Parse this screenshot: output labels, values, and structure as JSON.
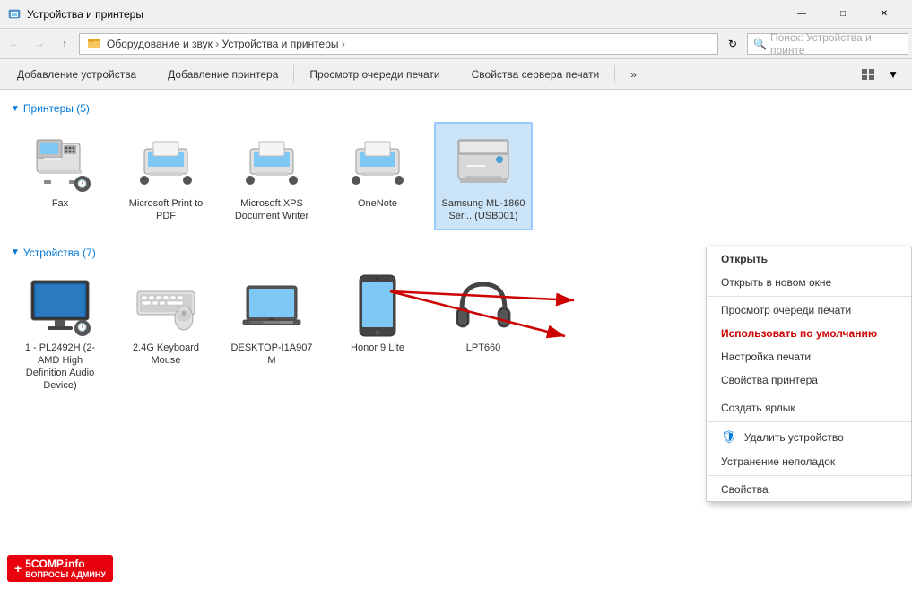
{
  "window": {
    "title": "Устройства и принтеры",
    "minimize_label": "—",
    "maximize_label": "□",
    "close_label": "✕"
  },
  "addressbar": {
    "back_title": "Назад",
    "forward_title": "Вперёд",
    "up_title": "Вверх",
    "breadcrumb": "Оборудование и звук  ›  Устройства и принтеры  ›",
    "refresh_title": "Обновить",
    "search_placeholder": "Поиск: Устройства и принте"
  },
  "toolbar": {
    "add_device": "Добавление устройства",
    "add_printer": "Добавление принтера",
    "print_queue": "Просмотр очереди печати",
    "server_props": "Свойства сервера печати",
    "more": "»"
  },
  "printers_section": {
    "label": "Принтеры (5)",
    "items": [
      {
        "name": "Fax",
        "selected": false
      },
      {
        "name": "Microsoft Print to PDF",
        "selected": false
      },
      {
        "name": "Microsoft XPS Document Writer",
        "selected": false
      },
      {
        "name": "OneNote",
        "selected": false
      },
      {
        "name": "Samsung ML-1860 Ser... (USB001)",
        "selected": true
      }
    ]
  },
  "devices_section": {
    "label": "Устройства (7)",
    "items": [
      {
        "name": "1 - PL2492H (2-AMD High Definition Audio Device)",
        "selected": false
      },
      {
        "name": "2.4G Keyboard Mouse",
        "selected": false
      },
      {
        "name": "DESKTOP-I1A907 M",
        "selected": false
      },
      {
        "name": "Honor 9 Lite",
        "selected": false
      },
      {
        "name": "LPT660",
        "selected": false
      }
    ]
  },
  "context_menu": {
    "open": "Открыть",
    "open_new_window": "Открыть в новом окне",
    "print_queue": "Просмотр очереди печати",
    "set_default": "Использовать по умолчанию",
    "print_settings": "Настройка печати",
    "printer_props": "Свойства принтера",
    "create_shortcut": "Создать ярлык",
    "remove_device": "Удалить устройство",
    "troubleshoot": "Устранение неполадок",
    "properties": "Свойства"
  },
  "watermark": {
    "text": "5COMP.info",
    "subtext": "ВОПРОСЫ АДМИНУ",
    "icon": "+"
  }
}
